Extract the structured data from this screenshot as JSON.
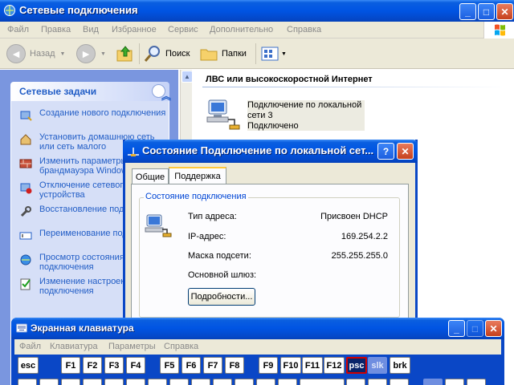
{
  "window": {
    "title": "Сетевые подключения",
    "controls": {
      "minimize": "_",
      "maximize": "□",
      "close": "✕"
    }
  },
  "menubar": [
    "Файл",
    "Правка",
    "Вид",
    "Избранное",
    "Сервис",
    "Дополнительно",
    "Справка"
  ],
  "toolbar": {
    "back": "Назад",
    "back_arrow": "◄",
    "forward_arrow": "►",
    "search": "Поиск",
    "folders": "Папки"
  },
  "task_panel": {
    "title": "Сетевые задачи",
    "collapse": "︽",
    "items": [
      {
        "label": "Создание нового подключения",
        "icon": "new-connection-icon"
      },
      {
        "label": "Установить домашнюю сеть или сеть малого",
        "icon": "home-network-icon"
      },
      {
        "label": "Изменить параметры брандмауэра Windows",
        "icon": "firewall-icon"
      },
      {
        "label": "Отключение сетевого устройства",
        "icon": "disable-device-icon"
      },
      {
        "label": "Восстановление подключения",
        "icon": "repair-icon"
      },
      {
        "label": "Переименование подключения",
        "icon": "rename-icon"
      },
      {
        "label": "Просмотр состояния подключения",
        "icon": "status-icon"
      },
      {
        "label": "Изменение настроек подключения",
        "icon": "settings-icon"
      }
    ]
  },
  "content": {
    "group_title": "ЛВС или высокоскоростной Интернет",
    "connection": {
      "line1": "Подключение по локальной",
      "line2": "сети 3",
      "line3": "Подключено"
    }
  },
  "dialog": {
    "title": "Состояние Подключение по локальной сет...",
    "help": "?",
    "close": "✕",
    "tabs": [
      "Общие",
      "Поддержка"
    ],
    "active_tab": "Поддержка",
    "group_label": "Состояние подключения",
    "rows": [
      {
        "label": "Тип адреса:",
        "value": "Присвоен DHCP"
      },
      {
        "label": "IP-адрес:",
        "value": "169.254.2.2"
      },
      {
        "label": "Маска подсети:",
        "value": "255.255.255.0"
      },
      {
        "label": "Основной шлюз:",
        "value": ""
      }
    ],
    "details_button": "Подробности..."
  },
  "osk": {
    "title": "Экранная клавиатура",
    "menu": [
      "Файл",
      "Клавиатура",
      "Параметры",
      "Справка"
    ],
    "keys": [
      "esc",
      "F1",
      "F2",
      "F3",
      "F4",
      "F5",
      "F6",
      "F7",
      "F8",
      "F9",
      "F10",
      "F11",
      "F12",
      "psc",
      "slk",
      "brk"
    ],
    "active_key": "psc",
    "dim_key": "slk"
  },
  "colors": {
    "xp_blue": "#0054e3",
    "task_link": "#215dc6",
    "legend_blue": "#0046d5",
    "keyboard_active": "#0a246a"
  }
}
